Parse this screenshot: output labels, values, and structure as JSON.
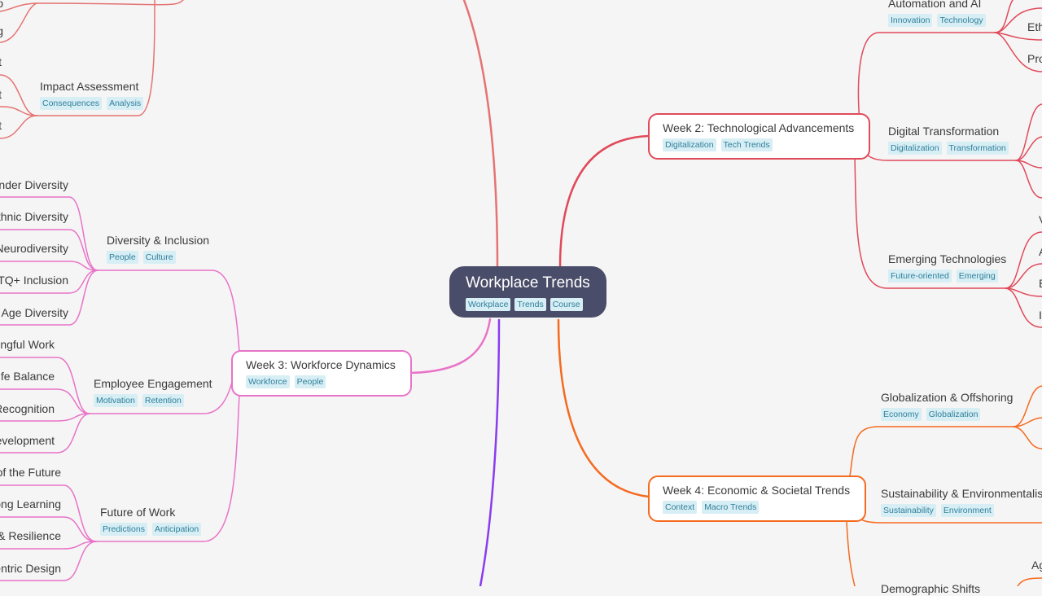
{
  "colors": {
    "background": "#f5f5f5",
    "root_fill": "#4a4d69",
    "tag_bg": "#d7eef5",
    "tag_text": "#2f7f9a",
    "week1_branch": "#e57373",
    "week2_branch": "#e04a5a",
    "week3_branch": "#e873c8",
    "week4_branch": "#f56a1f",
    "week5_branch": "#8a3cf0"
  },
  "root": {
    "title": "Workplace Trends",
    "tags": [
      "Workplace",
      "Trends",
      "Course"
    ]
  },
  "week2": {
    "title": "Week 2: Technological Advancements",
    "tags": [
      "Digitalization",
      "Tech Trends"
    ],
    "topics": [
      {
        "title": "Automation and AI",
        "tags": [
          "Innovation",
          "Technology"
        ],
        "children": [
          "Eth",
          "Pro"
        ]
      },
      {
        "title": "Digital Transformation",
        "tags": [
          "Digitalization",
          "Transformation"
        ]
      },
      {
        "title": "Emerging Technologies",
        "tags": [
          "Future-oriented",
          "Emerging"
        ],
        "children": [
          "V",
          "A",
          "B",
          "I"
        ]
      }
    ]
  },
  "week3": {
    "title": "Week 3:  Workforce Dynamics",
    "tags": [
      "Workforce",
      "People"
    ],
    "topics": [
      {
        "title": "Diversity & Inclusion",
        "tags": [
          "People",
          "Culture"
        ],
        "children": [
          "ender Diversity",
          "thnic Diversity",
          "Neurodiversity",
          "BTQ+ Inclusion",
          "Age Diversity"
        ]
      },
      {
        "title": "Employee Engagement",
        "tags": [
          "Motivation",
          "Retention"
        ],
        "children": [
          "ingful Work",
          "Life Balance",
          "Recognition",
          "evelopment"
        ]
      },
      {
        "title": "Future of Work",
        "tags": [
          "Predictions",
          "Anticipation"
        ],
        "children": [
          "of the Future",
          "ong Learning",
          "y & Resilience",
          "entric Design"
        ]
      }
    ]
  },
  "week4": {
    "title": "Week 4: Economic & Societal Trends",
    "tags": [
      "Context",
      "Macro Trends"
    ],
    "topics": [
      {
        "title": "Globalization & Offshoring",
        "tags": [
          "Economy",
          "Globalization"
        ]
      },
      {
        "title": "Sustainability & Environmentalism",
        "tags": [
          "Sustainability",
          "Environment"
        ]
      },
      {
        "title": "Demographic Shifts",
        "children": [
          "Ag"
        ]
      }
    ]
  },
  "week1": {
    "topics": [
      {
        "title": "Impact Assessment",
        "tags": [
          "Consequences",
          "Analysis"
        ],
        "children": [
          "t",
          "t",
          "t"
        ]
      }
    ],
    "edge_fragments": [
      "o",
      "g"
    ]
  }
}
